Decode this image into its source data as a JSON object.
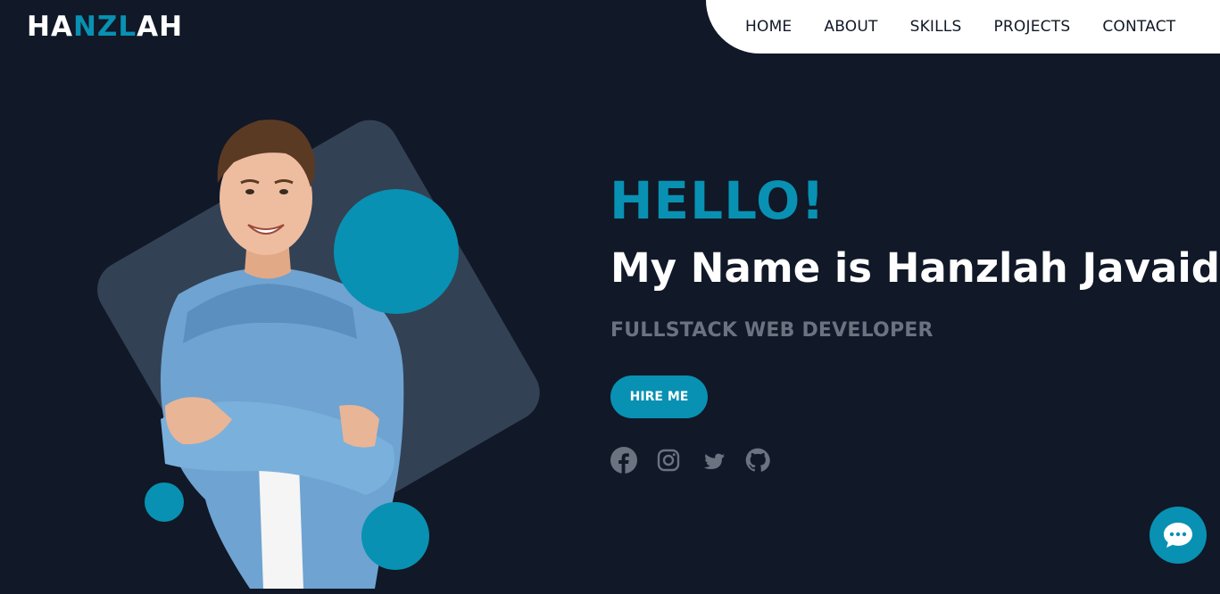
{
  "logo": {
    "part1": "HA",
    "part2": "NZL",
    "part3": "AH"
  },
  "nav": {
    "items": [
      {
        "label": "HOME"
      },
      {
        "label": "ABOUT"
      },
      {
        "label": "SKILLS"
      },
      {
        "label": "PROJECTS"
      },
      {
        "label": "CONTACT"
      }
    ]
  },
  "hero": {
    "greeting": "HELLO!",
    "name": "My Name is Hanzlah Javaid",
    "role": "FULLSTACK WEB DEVELOPER",
    "cta_label": "HIRE ME"
  },
  "socials": [
    {
      "icon": "facebook-icon"
    },
    {
      "icon": "instagram-icon"
    },
    {
      "icon": "twitter-icon"
    },
    {
      "icon": "github-icon"
    }
  ],
  "colors": {
    "background": "#111827",
    "accent": "#0891b2",
    "panel": "#334155",
    "muted": "#6b7280"
  },
  "chat": {
    "icon": "chat-bubble-icon"
  }
}
